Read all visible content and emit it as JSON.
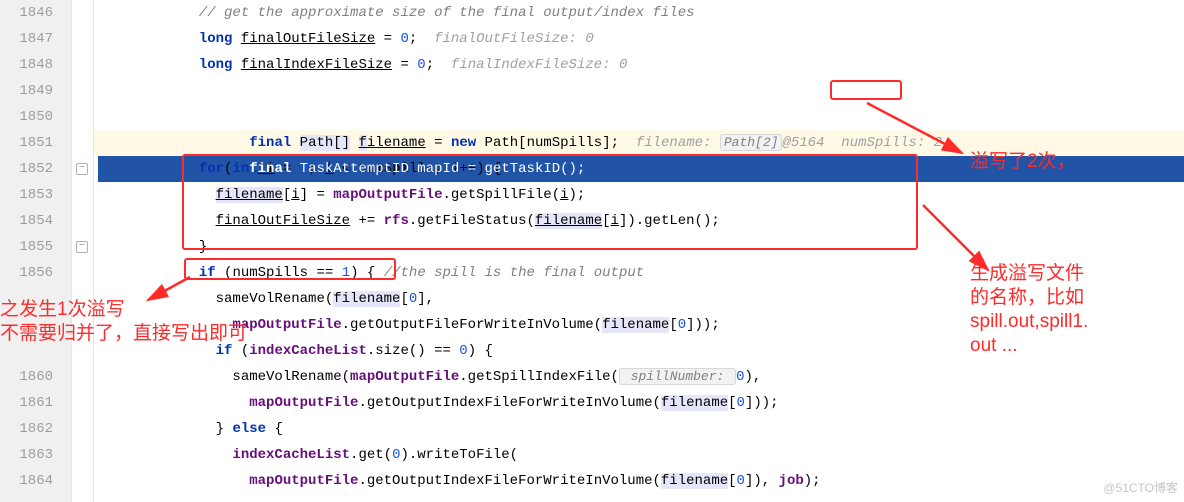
{
  "gutter": {
    "start": 1846,
    "lines": [
      "1846",
      "1847",
      "1848",
      "1849",
      "1850",
      "1851",
      "1852",
      "1853",
      "1854",
      "1855",
      "1856",
      "",
      "",
      "",
      "1860",
      "1861",
      "1862",
      "1863",
      "1864"
    ]
  },
  "code": {
    "l0": {
      "comment": "// get the approximate size of the final output/index files"
    },
    "l1": {
      "kw": "long",
      "var": "finalOutFileSize",
      "eq": " = ",
      "num": "0",
      "semi": ";",
      "inlay": "  finalOutFileSize: 0"
    },
    "l2": {
      "kw": "long",
      "var": "finalIndexFileSize",
      "eq": " = ",
      "num": "0",
      "semi": ";",
      "inlay": "  finalIndexFileSize: 0"
    },
    "l3": {
      "kw": "final",
      "type": "Path[]",
      "var": "filename",
      "eq": " = ",
      "new": "new",
      "ctor": " Path[",
      "arg": "numSpills",
      "close": "];",
      "inlay1": "  filename: ",
      "inlayBox": "Path[2]",
      "inlay2": "@5164",
      "inlay3": "  numSpills: 2"
    },
    "l4": {
      "kw": "final",
      "type": " TaskAttemptID ",
      "var": "mapId",
      "eq": " = ",
      "call": "getTaskID();"
    },
    "l6": {
      "kw": "for",
      "open": "(",
      "kw2": "int",
      "v": " i",
      "eq": " = ",
      "n0": "0",
      "semi": "; ",
      "v2": "i",
      "lt": " < ",
      "cond": "numSpills",
      "semi2": "; ",
      "inc": "i++",
      "close": ") {"
    },
    "l7": {
      "lhs": "filename",
      "idx": "[",
      "i": "i",
      "idx2": "] = ",
      "obj": "mapOutputFile",
      "dot": ".getSpillFile(",
      "arg": "i",
      "end": ");"
    },
    "l8": {
      "lhs": "finalOutFileSize",
      "op": " += ",
      "obj": "rfs",
      "m": ".getFileStatus(",
      "arg": "filename",
      "idx": "[",
      "i": "i",
      "idx2": "]).getLen();"
    },
    "l9": {
      "close": "}"
    },
    "l10": {
      "kw": "if",
      "open": " (",
      "cond": "numSpills",
      "eq": " == ",
      "n": "1",
      "close": ") {",
      "comment": " //the spill is the final output"
    },
    "l11": {
      "call": "sameVolRename(",
      "arg": "filename",
      "idx": "[",
      "n": "0",
      "end": "],"
    },
    "l12": {
      "obj": "mapOutputFile",
      "m": ".getOutputFileForWriteInVolume(",
      "arg": "filename",
      "idx": "[",
      "n": "0",
      "end": "]));"
    },
    "l13": {
      "kw": "if",
      "open": " (",
      "obj": "indexCacheList",
      "m": ".size() == ",
      "n": "0",
      "close": ") {"
    },
    "l14": {
      "call": "sameVolRename(",
      "obj": "mapOutputFile",
      "m": ".getSpillIndexFile(",
      "inlay": " spillNumber: ",
      "n": "0",
      "end": "),"
    },
    "l15": {
      "obj": "mapOutputFile",
      "m": ".getOutputIndexFileForWriteInVolume(",
      "arg": "filename",
      "idx": "[",
      "n": "0",
      "end": "]));"
    },
    "l16": {
      "close": "} ",
      "kw": "else",
      "open": " {"
    },
    "l17": {
      "obj": "indexCacheList",
      "m": ".get(",
      "n": "0",
      "m2": ").writeToFile("
    },
    "l18": {
      "obj": "mapOutputFile",
      "m": ".getOutputIndexFileForWriteInVolume(",
      "arg": "filename",
      "idx": "[",
      "n": "0",
      "end": "]), ",
      "job": "job",
      "final": ");"
    }
  },
  "annotations": {
    "right1": "溢写了2次，",
    "right2_l1": "生成溢写文件",
    "right2_l2": "的名称，比如",
    "right2_l3": "spill.out,spill1.",
    "right2_l4": "out ...",
    "left_l1": "之发生1次溢写",
    "left_l2": "不需要归并了，直接写出即可"
  },
  "watermark": "@51CTO博客"
}
